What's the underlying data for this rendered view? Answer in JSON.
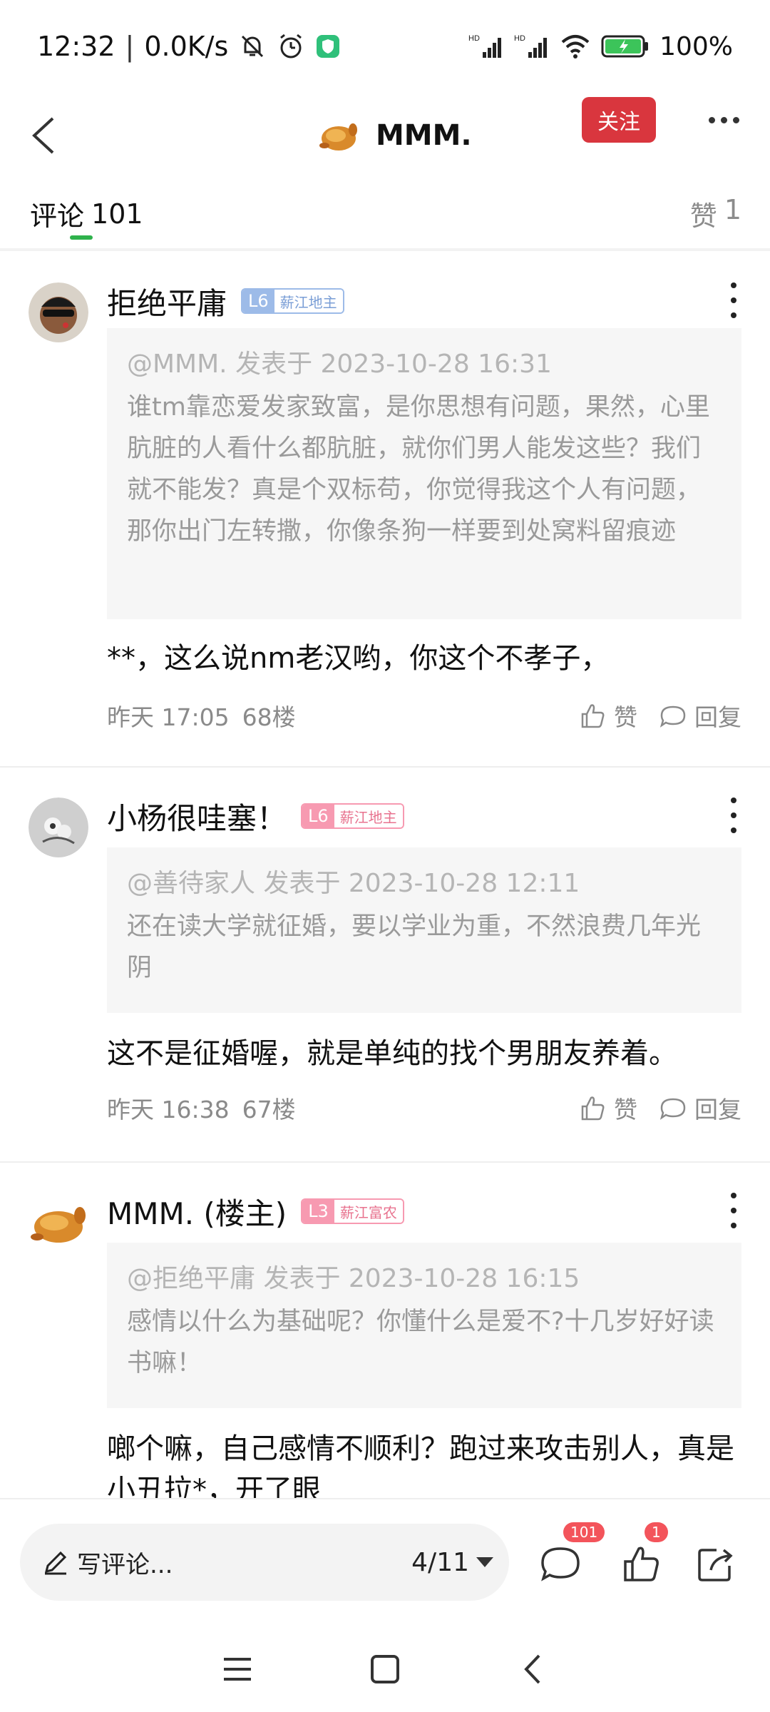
{
  "status_bar": {
    "time": "12:32",
    "net_speed": "0.0K/s",
    "battery": "100%",
    "signal_1": "HD",
    "signal_2": "HD"
  },
  "header": {
    "title": "MMM.",
    "follow_label": "关注"
  },
  "tabs": {
    "comments_label": "评论",
    "comments_count": "101",
    "likes_label": "赞",
    "likes_count": "1"
  },
  "comments": [
    {
      "username": "拒绝平庸",
      "level": "L6",
      "level_title": "薪江地主",
      "level_color": "#9dbbe8",
      "quote_meta": "@MMM. 发表于 2023-10-28 16:31",
      "quote_text": "谁tm靠恋爱发家致富，是你思想有问题，果然，心里肮脏的人看什么都肮脏，就你们男人能发这些？我们就不能发？真是个双标苟，你觉得我这个人有问题，那你出门左转撒，你像条狗一样要到处窝料留痕迹",
      "reply": "**，这么说nm老汉哟，你这个不孝子，",
      "time": "昨天 17:05",
      "floor": "68楼",
      "like_label": "赞",
      "reply_label": "回复"
    },
    {
      "username": "小杨很哇塞！",
      "level": "L6",
      "level_title": "薪江地主",
      "level_color": "#f79ab1",
      "quote_meta": "@善待家人 发表于 2023-10-28 12:11",
      "quote_text": "还在读大学就征婚，要以学业为重，不然浪费几年光阴",
      "reply": "这不是征婚喔，就是单纯的找个男朋友养着。",
      "time": "昨天 16:38",
      "floor": "67楼",
      "like_label": "赞",
      "reply_label": "回复"
    },
    {
      "username": "MMM. (楼主)",
      "level": "L3",
      "level_title": "薪江富农",
      "level_color": "#f79ab1",
      "quote_meta": "@拒绝平庸 发表于 2023-10-28 16:15",
      "quote_text": "感情以什么为基础呢？你懂什么是爱不?十几岁好好读书嘛！",
      "reply": "啷个嘛，自己感情不顺利？跑过来攻击别人，真是小丑拉*，开了眼",
      "time": "",
      "floor": "",
      "like_label": "",
      "reply_label": ""
    }
  ],
  "bottom_bar": {
    "input_placeholder": "写评论...",
    "page_indicator": "4/11",
    "comment_badge": "101",
    "like_badge": "1"
  },
  "colors": {
    "accent_green": "#2fb24c",
    "follow_red": "#d9363e",
    "badge_red": "#f3545b"
  }
}
